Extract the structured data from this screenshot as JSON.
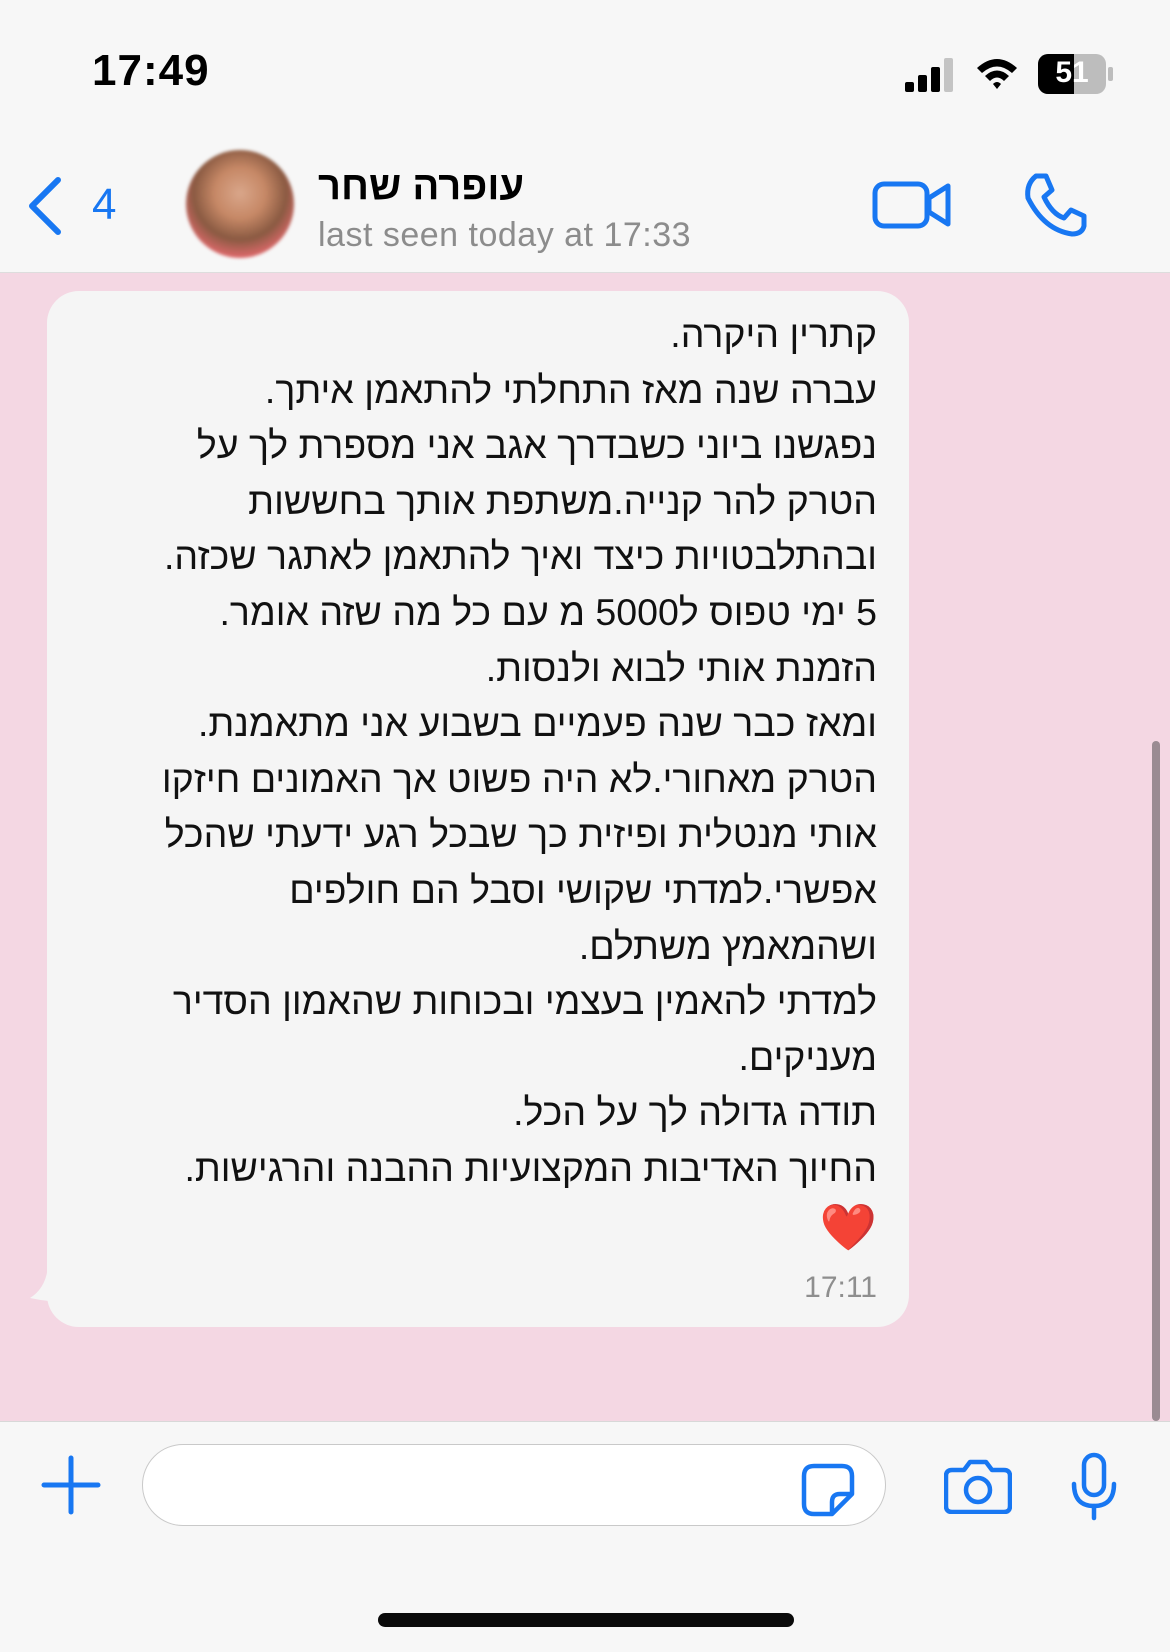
{
  "status_bar": {
    "time": "17:49",
    "battery": "51",
    "signal_icon": "signal-icon",
    "wifi_icon": "wifi-icon",
    "battery_icon": "battery-icon"
  },
  "header": {
    "back_count": "4",
    "contact_name": "עופרה שחר",
    "contact_status": "last seen today at 17:33",
    "icons": [
      "back-chevron-icon",
      "video-call-icon",
      "phone-call-icon"
    ],
    "accent_color": "#1877f2"
  },
  "chat": {
    "background_color": "#f4d7e3",
    "message": {
      "lines": [
        "קתרין היקרה.",
        "עברה שנה מאז התחלתי להתאמן איתך.",
        "נפגשנו ביוני כשבדרך אגב אני מספרת לך על",
        "הטרק להר קנייה.משתפת אותך בחששות",
        "ובהתלבטויות כיצד ואיך להתאמן לאתגר שכזה.",
        "5 ימי טפוס ל5000 מ  עם כל מה שזה אומר.",
        "הזמנת אותי לבוא ולנסות.",
        "ומאז כבר שנה פעמיים בשבוע אני מתאמנת.",
        "הטרק מאחורי.לא היה פשוט אך האמונים חיזקו",
        "אותי מנטלית ופיזית כך שבכל רגע ידעתי שהכל",
        "אפשרי.למדתי שקושי וסבל הם חולפים",
        "ושהמאמץ משתלם.",
        "למדתי להאמין בעצמי ובכוחות שהאמון הסדיר",
        "מעניקים.",
        "תודה גדולה לך על הכל.",
        "החיוך האדיבות המקצועיות ההבנה והרגישות."
      ],
      "emoji": "❤️",
      "time": "17:11"
    }
  },
  "input_bar": {
    "icons": [
      "plus-icon",
      "sticker-icon",
      "camera-icon",
      "microphone-icon"
    ],
    "placeholder": ""
  }
}
